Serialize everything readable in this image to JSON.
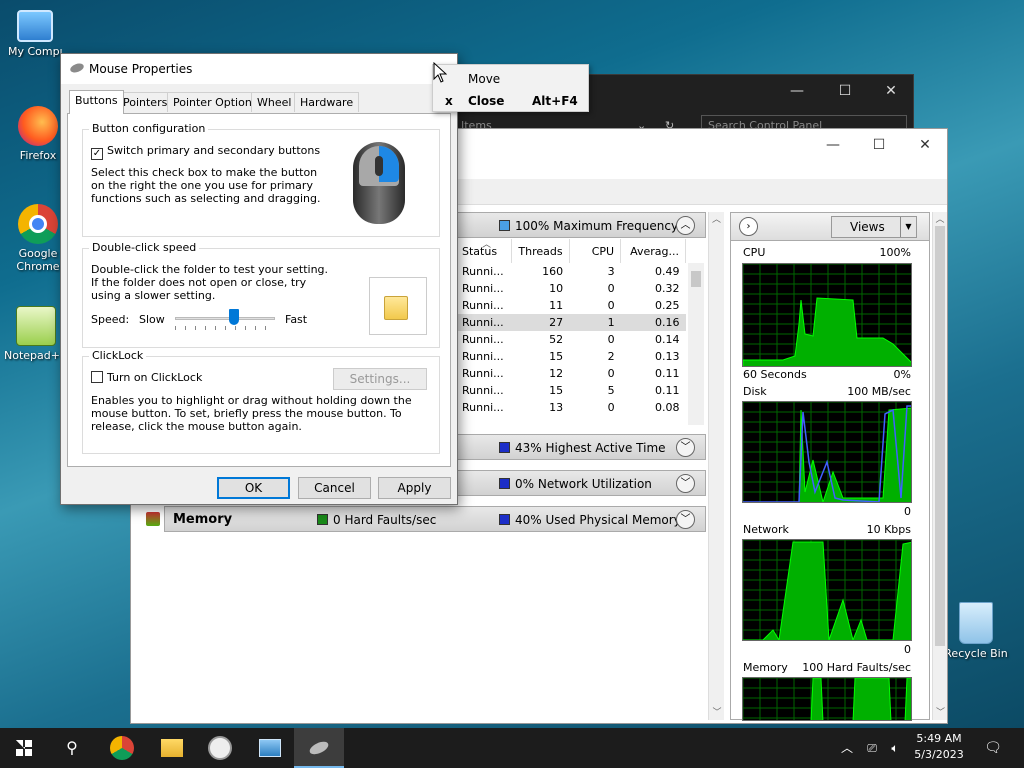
{
  "desktop": {
    "icons": [
      {
        "label": "My Computer"
      },
      {
        "label": "Firefox"
      },
      {
        "label": "Google Chrome"
      },
      {
        "label": "Notepad++"
      },
      {
        "label": "Recycle Bin"
      }
    ]
  },
  "control_panel": {
    "address_fragment": "Items",
    "search_placeholder": "Search Control Panel"
  },
  "resource_monitor": {
    "cpu_header_info": "100% Maximum Frequency",
    "columns": [
      "Status",
      "Threads",
      "CPU",
      "Averag..."
    ],
    "rows": [
      {
        "status": "Runni...",
        "threads": "160",
        "cpu": "3",
        "avg": "0.49"
      },
      {
        "status": "Runni...",
        "threads": "10",
        "cpu": "0",
        "avg": "0.32"
      },
      {
        "status": "Runni...",
        "threads": "11",
        "cpu": "0",
        "avg": "0.25"
      },
      {
        "status": "Runni...",
        "threads": "27",
        "cpu": "1",
        "avg": "0.16"
      },
      {
        "status": "Runni...",
        "threads": "52",
        "cpu": "0",
        "avg": "0.14"
      },
      {
        "status": "Runni...",
        "threads": "15",
        "cpu": "2",
        "avg": "0.13"
      },
      {
        "status": "Runni...",
        "threads": "12",
        "cpu": "0",
        "avg": "0.11"
      },
      {
        "status": "Runni...",
        "threads": "15",
        "cpu": "5",
        "avg": "0.11"
      },
      {
        "status": "Runni...",
        "threads": "13",
        "cpu": "0",
        "avg": "0.08"
      }
    ],
    "disk_info": "43% Highest Active Time",
    "network_info": "0% Network Utilization",
    "memory_title": "Memory",
    "memory_faults": "0 Hard Faults/sec",
    "memory_info": "40% Used Physical Memory",
    "views_label": "Views",
    "graphs": {
      "cpu": {
        "label": "CPU",
        "max": "100%",
        "time": "60 Seconds",
        "min": "0%"
      },
      "disk": {
        "label": "Disk",
        "max": "100 MB/sec",
        "min": "0"
      },
      "network": {
        "label": "Network",
        "max": "10 Kbps",
        "min": "0"
      },
      "memory": {
        "label": "Memory",
        "max": "100 Hard Faults/sec"
      }
    },
    "colors": {
      "green": "#00ff00",
      "blue": "#4060ff",
      "cpu_sq": "#4aa0e6",
      "disk_sq": "#1c2ec8"
    }
  },
  "mouse_properties": {
    "title": "Mouse Properties",
    "tabs": [
      "Buttons",
      "Pointers",
      "Pointer Options",
      "Wheel",
      "Hardware"
    ],
    "active_tab": "Buttons",
    "button_config": {
      "group": "Button configuration",
      "checkbox": "Switch primary and secondary buttons",
      "checked": true,
      "desc": "Select this check box to make the button on the right the one you use for primary functions such as selecting and dragging."
    },
    "double_click": {
      "group": "Double-click speed",
      "desc": "Double-click the folder to test your setting. If the folder does not open or close, try using a slower setting.",
      "speed_label": "Speed:",
      "slow": "Slow",
      "fast": "Fast",
      "slider_fraction": 0.6
    },
    "clicklock": {
      "group": "ClickLock",
      "checkbox": "Turn on ClickLock",
      "checked": false,
      "settings": "Settings...",
      "desc": "Enables you to highlight or drag without holding down the mouse button. To set, briefly press the mouse button. To release, click the mouse button again."
    },
    "buttons": {
      "ok": "OK",
      "cancel": "Cancel",
      "apply": "Apply"
    }
  },
  "context_menu": {
    "items": [
      {
        "icon": "",
        "label": "Move",
        "shortcut": ""
      },
      {
        "icon": "x",
        "label": "Close",
        "shortcut": "Alt+F4"
      }
    ]
  },
  "taskbar": {
    "time": "5:49 AM",
    "date": "5/3/2023"
  }
}
